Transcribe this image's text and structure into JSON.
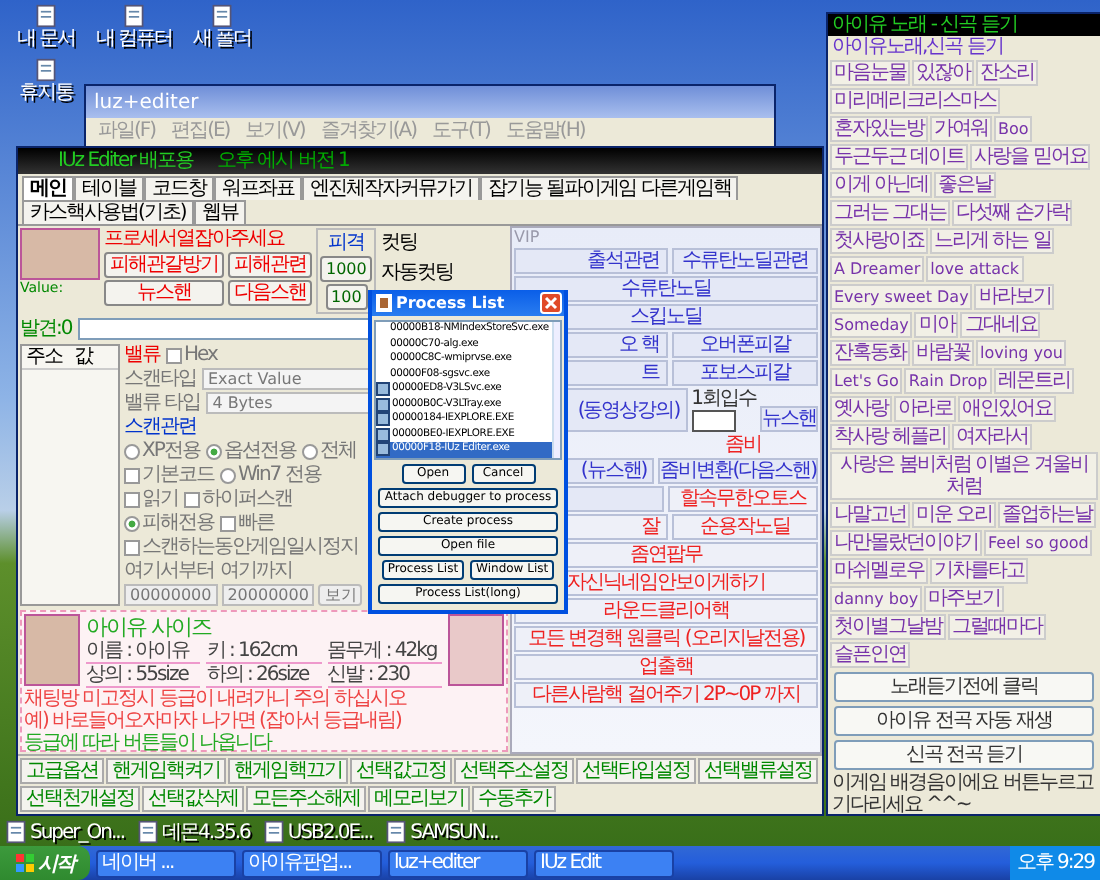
{
  "desktop_icons_top": [
    {
      "label": "내 문서"
    },
    {
      "label": "내 컴퓨터"
    },
    {
      "label": "새 폴더"
    },
    {
      "label": "휴지통"
    }
  ],
  "desktop_icons_bottom": [
    {
      "label": "Super_On..."
    },
    {
      "label": "데몬4.35.6"
    },
    {
      "label": "USB2.0E..."
    },
    {
      "label": "SAMSUN..."
    }
  ],
  "background_window": {
    "title": "luz+editer",
    "menu": [
      "파일(F)",
      "편집(E)",
      "보기(V)",
      "즐겨찾기(A)",
      "도구(T)",
      "도움말(H)"
    ]
  },
  "main_window": {
    "title": "IUz Editer 배포용",
    "subtitle": "오후 에시 버전 1",
    "tabs": [
      {
        "label": "메인",
        "selected": true
      },
      {
        "label": "테이블",
        "selected": false
      },
      {
        "label": "코드창",
        "selected": false
      },
      {
        "label": "워프좌표",
        "selected": false
      },
      {
        "label": "엔진체작자커뮤가기",
        "selected": false
      },
      {
        "label": "잡기능 될파이게임 다른게임핵",
        "selected": false
      },
      {
        "label": "카스핵사용법(기초)",
        "selected": false
      },
      {
        "label": "웹뷰",
        "selected": false
      }
    ],
    "value_label": "Value:",
    "process_hint": "프로세서열잡아주세요",
    "action_buttons": [
      "피해관갈방기",
      "피해관련",
      "뉴스핸",
      "다음스핸"
    ],
    "hit_group": {
      "title": "피격",
      "buttons": [
        "1000",
        "100"
      ]
    },
    "cutting": [
      "컷팅",
      "자동컷팅"
    ],
    "found": "발견:0",
    "address_list": {
      "columns": [
        "주소",
        "값"
      ]
    },
    "scan": {
      "value_label": "밸류",
      "hex": {
        "label": "Hex",
        "checked": false
      },
      "scan_type_label": "스캔타입",
      "scan_type": "Exact Value",
      "value_type_label": "밸류 타입",
      "value_type": "4 Bytes",
      "group_title": "스캔관련",
      "options": [
        {
          "kind": "radio",
          "label": "XP전용",
          "checked": false
        },
        {
          "kind": "radio",
          "label": "옵션전용",
          "checked": true
        },
        {
          "kind": "radio",
          "label": "전체",
          "checked": false
        },
        {
          "kind": "checkbox",
          "label": "기본코드",
          "checked": false
        },
        {
          "kind": "radio",
          "label": "Win7 전용",
          "checked": false
        },
        {
          "kind": "checkbox",
          "label": "읽기",
          "checked": false
        },
        {
          "kind": "checkbox",
          "label": "하이퍼스캔",
          "checked": false
        },
        {
          "kind": "radio",
          "label": "피해전용",
          "checked": true
        },
        {
          "kind": "checkbox",
          "label": "빠른",
          "checked": false
        },
        {
          "kind": "checkbox",
          "label": "스캔하는동안게임일시정지",
          "checked": false
        }
      ],
      "from_label": "여기서부터",
      "to_label": "여기까지",
      "from_value": "00000000",
      "to_value": "20000000",
      "view_button": "보기"
    },
    "profile": {
      "title": "아이유 사이즈",
      "lines": [
        "이름 : 아이유",
        "키 : 162cm",
        "몸무게 : 42kg",
        "상의 : 55size",
        "하의 : 26size",
        "신발 : 230"
      ]
    },
    "warnings": [
      "채팅방 미고정시 등급이 내려가니 주의 하십시오",
      "예) 바로들어오자마자 나가면 (잡아서 등급내림)"
    ],
    "grade_note": "등급에 따라 버튼들이 나옵니다",
    "vip": {
      "title": "VIP",
      "rows": [
        [
          {
            "kind": "button",
            "label": "출석관련"
          },
          {
            "kind": "button",
            "label": "수류탄노딜관련"
          }
        ],
        [
          {
            "kind": "button",
            "label": "수류탄노딜"
          }
        ],
        [
          {
            "kind": "button",
            "label": "스킵노딜"
          }
        ],
        [
          {
            "kind": "button",
            "label": "오 핵"
          },
          {
            "kind": "button",
            "label": "오버폰피갈"
          }
        ],
        [
          {
            "kind": "button",
            "label": "트"
          },
          {
            "kind": "button",
            "label": "포보스피갈"
          }
        ],
        [
          {
            "kind": "button",
            "label": "(동영상강의)"
          },
          {
            "kind": "field-button",
            "label": "1회입수",
            "button": "뉴스핸"
          }
        ],
        [
          {
            "kind": "spacer"
          },
          {
            "kind": "red-label",
            "label": "좀비"
          }
        ],
        [
          {
            "kind": "button",
            "label": "(뉴스핸)"
          },
          {
            "kind": "button",
            "label": "좀비변환(다음스핸)"
          }
        ],
        [
          {
            "kind": "blank"
          },
          {
            "kind": "red-button",
            "label": "할속무한오토스"
          }
        ],
        [
          {
            "kind": "red-button",
            "label": "잘"
          },
          {
            "kind": "red-button",
            "label": "순용작노딜"
          }
        ],
        [
          {
            "kind": "red-button",
            "label": "좀연팝무"
          }
        ],
        [
          {
            "kind": "red-button",
            "label": "자신닉네임안보이게하기"
          }
        ],
        [
          {
            "kind": "red-button",
            "label": "라운드클리어핵"
          }
        ],
        [
          {
            "kind": "red-button",
            "label": "모든 변경핵 원클릭 (오리지날전용)"
          }
        ],
        [
          {
            "kind": "red-button",
            "label": "업출핵"
          }
        ],
        [
          {
            "kind": "red-button",
            "label": "다른사람핵 걸어주기 2P~0P 까지"
          }
        ]
      ]
    },
    "bottom_tabs": [
      "고급옵션",
      "핸게임핵켜기",
      "핸게임핵끄기",
      "선택값고정",
      "선택주소설정",
      "선택타입설정",
      "선택밸류설정",
      "선택천개설정",
      "선택값삭제",
      "모든주소해제",
      "메모리보기",
      "수동추가"
    ]
  },
  "music_window": {
    "title": "아이유 노래 - 신곡 듣기",
    "heading": "아이유노래,신곡 듣기",
    "songs": [
      "마음눈물",
      "있잖아",
      "잔소리",
      "미리메리크리스마스",
      "혼자있는방",
      "가여워",
      "Boo",
      "두근두근 데이트",
      "사랑을 믿어요",
      "이게 아닌데",
      "좋은날",
      "그러는 그대는",
      "다섯째 손가락",
      "첫사랑이죠",
      "느리게 하는 일",
      "A Dreamer",
      "love attack",
      "Every sweet Day",
      "바라보기",
      "Someday",
      "미아",
      "그대네요",
      "잔혹동화",
      "바람꽃",
      "loving you",
      "Let's Go",
      "Rain Drop",
      "레몬트리",
      "옛사랑",
      "아라로",
      "애인있어요",
      "착사랑 헤플리",
      "여자라서",
      "사랑은 봄비처럼 이별은 겨울비처럼",
      "나말고넌",
      "미운 오리",
      "졸업하는날",
      "나만몰랐던이야기",
      "Feel so good",
      "마쉬멜로우",
      "기차를타고",
      "danny boy",
      "마주보기",
      "첫이별그날밤",
      "그럴때마다",
      "슬픈인연"
    ],
    "buttons": [
      "노래듣기전에 클릭",
      "아이유 전곡 자동 재생",
      "신곡 전곡 듣기"
    ],
    "marquee": "이게임 배경음이에요 버튼누르고 기다리세요 ^^~"
  },
  "process_dialog": {
    "title": "Process List",
    "processes": [
      {
        "label": "00000B18-NMIndexStoreSvc.exe",
        "selected": false
      },
      {
        "label": "00000C70-alg.exe",
        "selected": false
      },
      {
        "label": "00000C8C-wmiprvse.exe",
        "selected": false
      },
      {
        "label": "00000F08-sgsvc.exe",
        "selected": false
      },
      {
        "label": "00000ED8-V3LSvc.exe",
        "selected": false
      },
      {
        "label": "00000B0C-V3LTray.exe",
        "selected": false
      },
      {
        "label": "00000184-IEXPLORE.EXE",
        "selected": false
      },
      {
        "label": "00000BE0-IEXPLORE.EXE",
        "selected": false
      },
      {
        "label": "00000F18-IUz Editer.exe",
        "selected": true
      }
    ],
    "open": "Open",
    "cancel": "Cancel",
    "actions": [
      "Attach debugger to process",
      "Create process",
      "Open file"
    ],
    "list_buttons": [
      "Process List",
      "Window List"
    ],
    "long_button": "Process List(long)"
  },
  "taskbar": {
    "start": "시작",
    "tasks": [
      "네이버 ...",
      "아이유판업...",
      "luz+editer",
      "IUz Edit"
    ],
    "clock": "오후 9:29"
  }
}
